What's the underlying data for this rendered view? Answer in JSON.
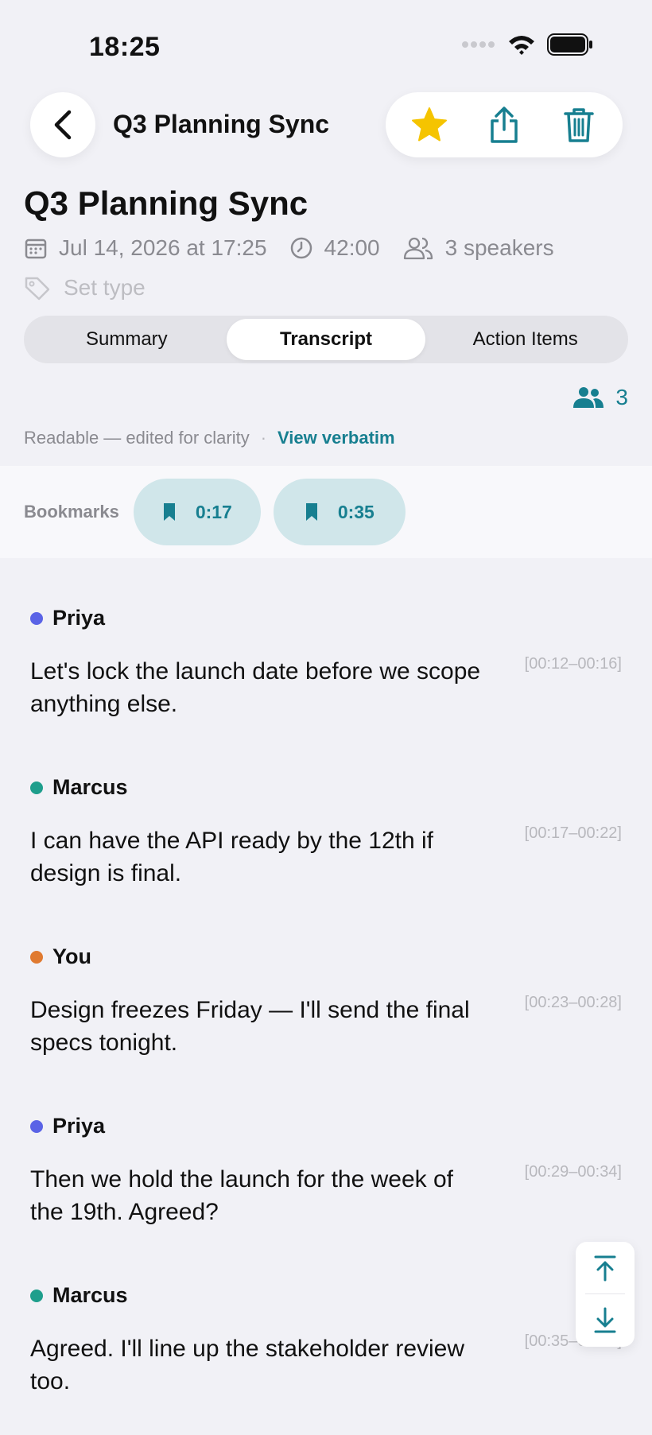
{
  "status": {
    "time": "18:25"
  },
  "nav": {
    "title": "Q3 Planning Sync"
  },
  "meeting": {
    "title": "Q3 Planning Sync",
    "date": "Jul 14, 2026 at 17:25",
    "duration": "42:00",
    "speakers": "3 speakers",
    "type_placeholder": "Set type"
  },
  "tabs": [
    {
      "label": "Summary"
    },
    {
      "label": "Transcript"
    },
    {
      "label": "Action Items"
    }
  ],
  "speaker_count": "3",
  "readable": {
    "note": "Readable — edited for clarity",
    "link": "View verbatim"
  },
  "bookmarks": {
    "label": "Bookmarks",
    "items": [
      {
        "time": "0:17"
      },
      {
        "time": "0:35"
      }
    ]
  },
  "transcript": [
    {
      "speaker": "Priya",
      "text": "Let's lock the launch date before we scope anything else.",
      "time": "[00:12–00:16]"
    },
    {
      "speaker": "Marcus",
      "text": "I can have the API ready by the 12th if design is final.",
      "time": "[00:17–00:22]"
    },
    {
      "speaker": "You",
      "text": "Design freezes Friday — I'll send the final specs tonight.",
      "time": "[00:23–00:28]"
    },
    {
      "speaker": "Priya",
      "text": "Then we hold the launch for the week of the 19th. Agreed?",
      "time": "[00:29–00:34]"
    },
    {
      "speaker": "Marcus",
      "text": "Agreed. I'll line up the stakeholder review too.",
      "time": "[00:35–00:40]"
    }
  ],
  "colors": {
    "accent": "#177f90",
    "favorite": "#f5c400",
    "speaker_priya": "#5a63e6",
    "speaker_marcus": "#1e9e8c",
    "speaker_you": "#e07a30"
  },
  "icons": [
    "back-chevron-icon",
    "star-icon",
    "share-icon",
    "trash-icon",
    "calendar-icon",
    "clock-icon",
    "people-icon",
    "tag-icon",
    "speakers-icon",
    "bookmark-icon",
    "scroll-top-icon",
    "scroll-bottom-icon"
  ]
}
